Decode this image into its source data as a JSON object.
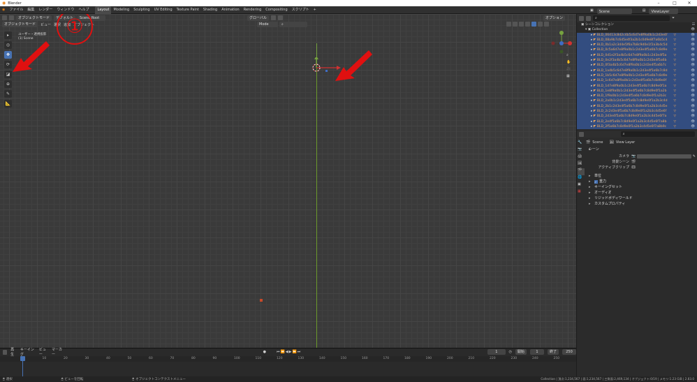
{
  "window": {
    "app_name": "Blender",
    "minimize": "–",
    "maximize": "□",
    "close": "✕"
  },
  "menu": {
    "items": [
      "ファイル",
      "編集",
      "レンダー",
      "ウィンドウ",
      "ヘルプ"
    ],
    "workspaces": [
      "Layout",
      "Modeling",
      "Sculpting",
      "UV Editing",
      "Texture Paint",
      "Shading",
      "Animation",
      "Rendering",
      "Compositing",
      "スクリプト"
    ],
    "active_workspace": "Layout",
    "add_tab": "+",
    "scene_label": "Scene",
    "view_layer_label": "ViewLayer"
  },
  "viewport_header": {
    "mode_btn": "オブジェクトモード",
    "items": [
      "ビュー",
      "選択",
      "追加",
      "オブジェクト"
    ],
    "global_btn": "グローバル",
    "options_btn": "オプション",
    "default_label": "デフォルト",
    "scene_name_field": "Scene Root",
    "mode_label": "Mode"
  },
  "viewport": {
    "overlay_text_1": "ユーザー・透視投影",
    "overlay_text_2": "(1) Scene",
    "annotation_number": "①",
    "bg_color": "#3a3a3a"
  },
  "outliner": {
    "title": "シーンコレクション",
    "collection": "Collection",
    "search_placeholder": "",
    "rows": [
      "BLD_06413c8d2c4b5c6d7e8f9a0b1c2d3e4f",
      "BLD_08a9b7c6d5e4f3a2b1c0d9e8f7a6b5c4",
      "BLD_0b1a2c3d4e5f6a7b8c9d0e1f2a3b4c5d",
      "BLD_0c5a6d7e8f9a0b1c2d3e4f5a6b7c8d9e",
      "BLD_0d1e2f3a4b5c6d7e8f9a0b1c2d3e4f5a",
      "BLD_0e2f3a4b5c6d7e8f9a0b1c2d3e4f5a6b",
      "BLD_0f3a4b5c6d7e8f9a0b1c2d3e4f5a6b7c",
      "BLD_1a4b5c6d7e8f9a0b1c2d3e4f5a6b7c8d",
      "BLD_1b5c6d7e8f9a0b1c2d3e4f5a6b7c8d9e",
      "BLD_1c6d7e8f9a0b1c2d3e4f5a6b7c8d9e0f",
      "BLD_1d7e8f9a0b1c2d3e4f5a6b7c8d9e0f1a",
      "BLD_1e8f9a0b1c2d3e4f5a6b7c8d9e0f1a2b",
      "BLD_1f9a0b1c2d3e4f5a6b7c8d9e0f1a2b3c",
      "BLD_2a0b1c2d3e4f5a6b7c8d9e0f1a2b3c4d",
      "BLD_2b1c2d3e4f5a6b7c8d9e0f1a2b3c4d5e",
      "BLD_2c2d3e4f5a6b7c8d9e0f1a2b3c4d5e6f",
      "BLD_2d3e4f5a6b7c8d9e0f1a2b3c4d5e6f7a",
      "BLD_2e4f5a6b7c8d9e0f1a2b3c4d5e6f7a8b",
      "BLD_2f5a6b7c8d9e0f1a2b3c4d5e6f7a8b9c"
    ]
  },
  "properties": {
    "tab_scene": "Scene",
    "tab_view_layer": "View Layer",
    "section_title": "シーン",
    "camera_label": "カメラ",
    "bg_scene_label": "背景シーン",
    "active_clip_label": "アクティブクリップ",
    "panels": [
      "単位",
      "重力",
      "キーイングセット",
      "オーディオ",
      "リジッドボディワールド",
      "カスタムプロパティ"
    ],
    "gravity_checked": true
  },
  "timeline": {
    "menu": [
      "再生",
      "キーイング",
      "ビュー",
      "マーカー"
    ],
    "current_frame": "1",
    "start_label": "開始",
    "start_value": "1",
    "end_label": "終了",
    "end_value": "250",
    "ticks": [
      "0",
      "10",
      "20",
      "30",
      "40",
      "50",
      "60",
      "70",
      "80",
      "90",
      "100",
      "110",
      "120",
      "130",
      "140",
      "150",
      "160",
      "170",
      "180",
      "190",
      "200",
      "210",
      "220",
      "230",
      "240",
      "250"
    ]
  },
  "statusbar": {
    "left_1": "選択",
    "left_2": "ビューを回転",
    "left_3": "オブジェクトコンテクストメニュー",
    "right": "Collection | 頂点:1,234,567 | 面:1,234,567 | 三角面:2,469,134 | オブジェクト:0/19 | メモリ:1.23 GiB | 2.83.0"
  },
  "colors": {
    "accent": "#4772b3",
    "annotation_red": "#e01010",
    "x_axis": "#d13232",
    "y_axis": "#76a33f"
  }
}
